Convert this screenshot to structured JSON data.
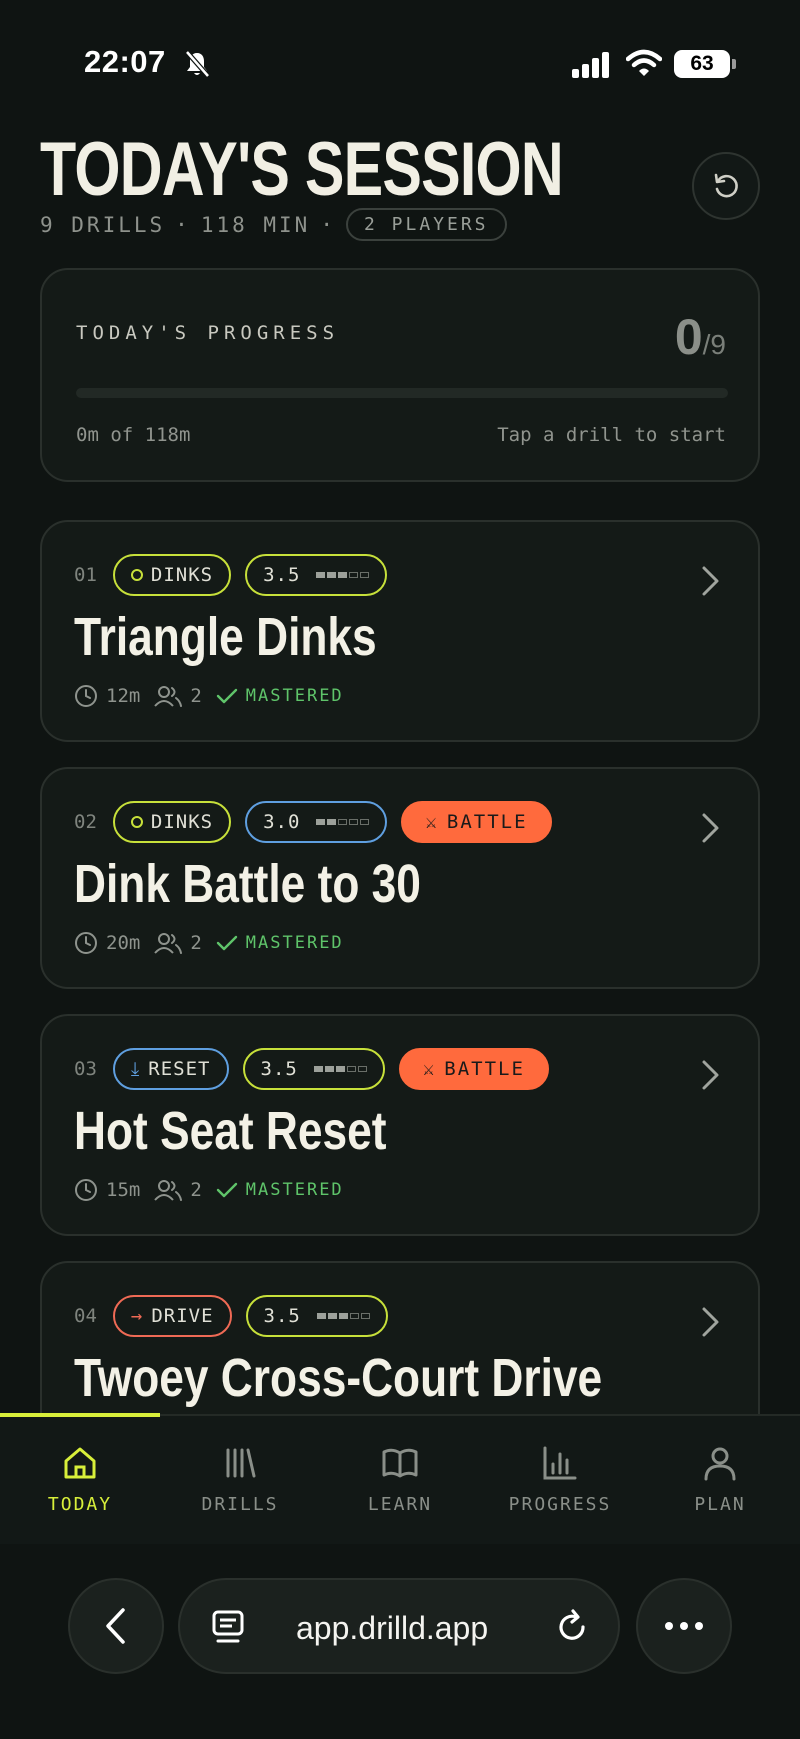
{
  "status": {
    "time": "22:07",
    "battery": "63"
  },
  "header": {
    "title": "TODAY'S SESSION",
    "drills": "9 DRILLS",
    "minutes": "118 MIN",
    "sep": "·",
    "players": "2 PLAYERS"
  },
  "progress": {
    "label": "TODAY'S PROGRESS",
    "done": "0",
    "total": "/9",
    "fraction": 0,
    "elapsed": "0m of 118m",
    "hint": "Tap a drill to start"
  },
  "drills": [
    {
      "num": "01",
      "category": "DINKS",
      "level": "3.5",
      "battle": "",
      "title": "Triangle Dinks",
      "duration": "12m",
      "players": "2",
      "status": "MASTERED"
    },
    {
      "num": "02",
      "category": "DINKS",
      "level": "3.0",
      "battle": "BATTLE",
      "title": "Dink Battle to 30",
      "duration": "20m",
      "players": "2",
      "status": "MASTERED"
    },
    {
      "num": "03",
      "category": "RESET",
      "level": "3.5",
      "battle": "BATTLE",
      "title": "Hot Seat Reset",
      "duration": "15m",
      "players": "2",
      "status": "MASTERED"
    },
    {
      "num": "04",
      "category": "DRIVE",
      "level": "3.5",
      "battle": "",
      "title": "Twoey Cross-Court Drive",
      "duration": "",
      "players": "",
      "status": ""
    }
  ],
  "tabs": [
    {
      "label": "TODAY",
      "icon": "home-icon",
      "active": true
    },
    {
      "label": "DRILLS",
      "icon": "library-icon",
      "active": false
    },
    {
      "label": "LEARN",
      "icon": "book-icon",
      "active": false
    },
    {
      "label": "PROGRESS",
      "icon": "bar-chart-icon",
      "active": false
    },
    {
      "label": "PLAN",
      "icon": "user-icon",
      "active": false
    }
  ],
  "browser": {
    "url": "app.drilld.app"
  },
  "colors": {
    "accent": "#d8ef3a",
    "battle": "#ff6a3d",
    "mastered": "#5fc46a",
    "reset": "#5f9fe0",
    "drive": "#ef6a55"
  }
}
